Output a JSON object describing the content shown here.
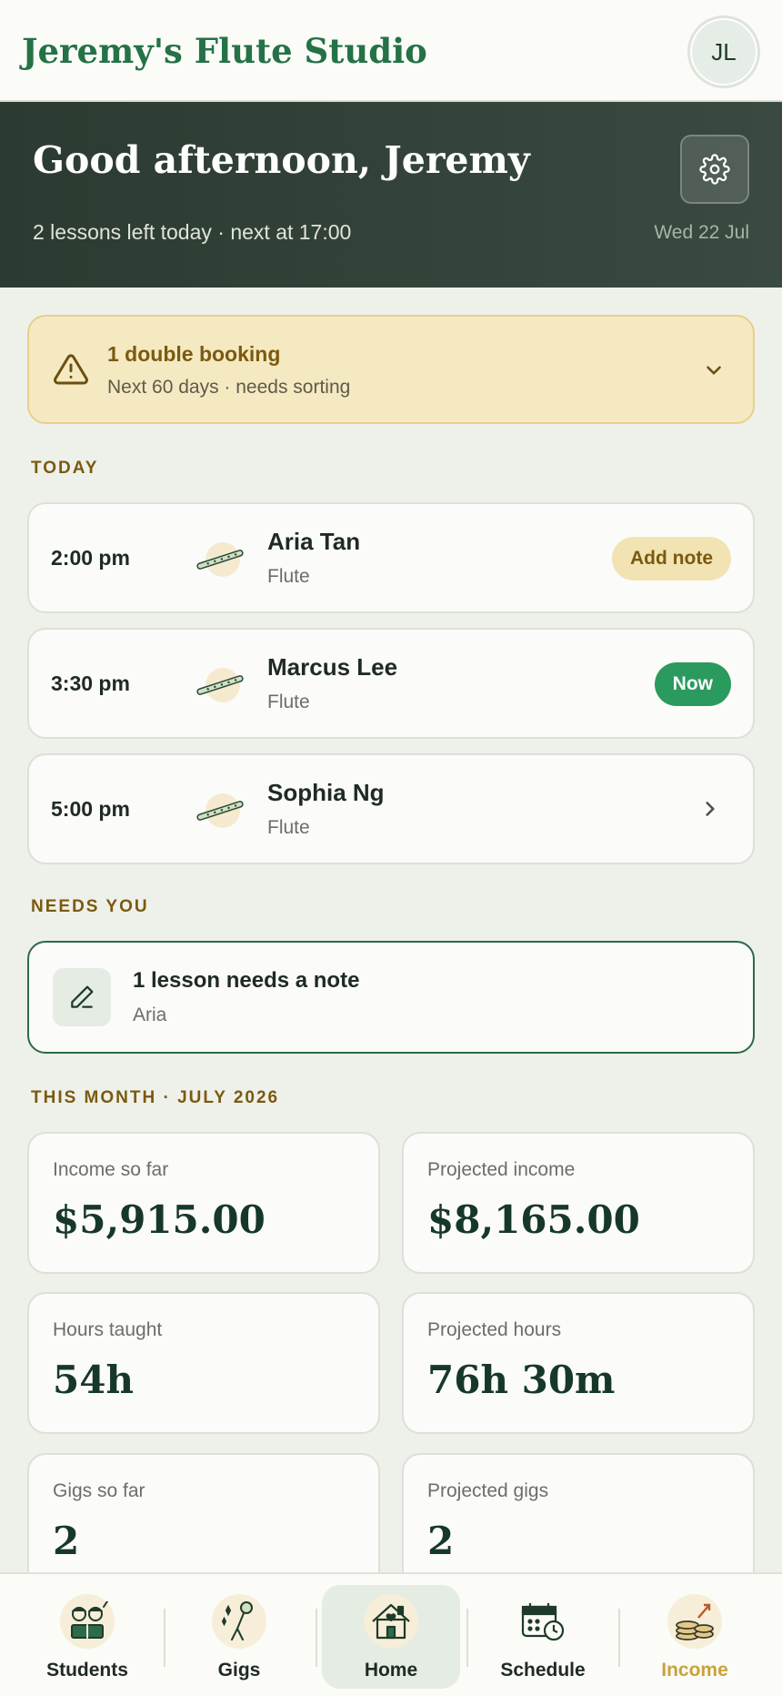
{
  "app": {
    "title": "Jeremy's Flute Studio",
    "avatar_initials": "JL"
  },
  "hero": {
    "greeting": "Good afternoon, Jeremy",
    "subtitle": "2 lessons left today · next at 17:00",
    "date": "Wed 22 Jul"
  },
  "alert": {
    "title": "1 double booking",
    "subtitle": "Next 60 days · needs sorting"
  },
  "today": {
    "label": "TODAY",
    "lessons": [
      {
        "time": "2:00 pm",
        "name": "Aria Tan",
        "instrument": "Flute",
        "action": "Add note"
      },
      {
        "time": "3:30 pm",
        "name": "Marcus Lee",
        "instrument": "Flute",
        "action": "Now"
      },
      {
        "time": "5:00 pm",
        "name": "Sophia Ng",
        "instrument": "Flute",
        "action": ""
      }
    ]
  },
  "needs_you": {
    "label": "NEEDS YOU",
    "title": "1 lesson needs a note",
    "subtitle": "Aria"
  },
  "month": {
    "label": "THIS MONTH · JULY 2026",
    "stats": [
      {
        "label": "Income so far",
        "value": "$5,915.00"
      },
      {
        "label": "Projected income",
        "value": "$8,165.00"
      },
      {
        "label": "Hours taught",
        "value": "54h"
      },
      {
        "label": "Projected hours",
        "value": "76h 30m"
      },
      {
        "label": "Gigs so far",
        "value": "2"
      },
      {
        "label": "Projected gigs",
        "value": "2"
      }
    ]
  },
  "nav": {
    "items": [
      {
        "label": "Students",
        "icon": "students-icon"
      },
      {
        "label": "Gigs",
        "icon": "gigs-icon"
      },
      {
        "label": "Home",
        "icon": "home-icon"
      },
      {
        "label": "Schedule",
        "icon": "schedule-icon"
      },
      {
        "label": "Income",
        "icon": "income-icon"
      }
    ],
    "active": "Home"
  },
  "colors": {
    "brand": "#247246",
    "hero_bg": "#2c3b31",
    "alert_bg": "#f5e9c2",
    "now_green": "#2b9a5e",
    "gold": "#c9a23a"
  }
}
